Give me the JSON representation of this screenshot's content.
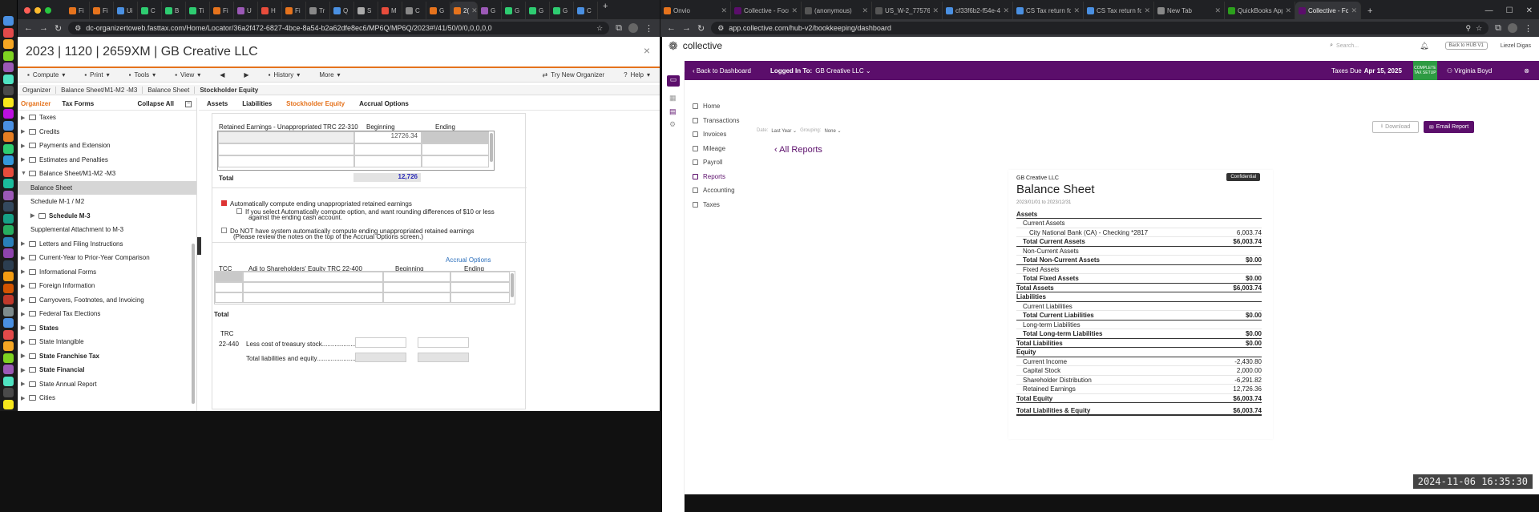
{
  "left_browser": {
    "tabs": [
      {
        "label": "Fi"
      },
      {
        "label": "Fi"
      },
      {
        "label": "Ui"
      },
      {
        "label": "C"
      },
      {
        "label": "B"
      },
      {
        "label": "Ti"
      },
      {
        "label": "Fi"
      },
      {
        "label": "U"
      },
      {
        "label": "H"
      },
      {
        "label": "Fi"
      },
      {
        "label": "Tr"
      },
      {
        "label": "Q"
      },
      {
        "label": "S"
      },
      {
        "label": "M"
      },
      {
        "label": "C"
      },
      {
        "label": "G"
      },
      {
        "label": "2("
      },
      {
        "label": "G"
      },
      {
        "label": "G"
      },
      {
        "label": "G"
      },
      {
        "label": "G"
      },
      {
        "label": "C"
      }
    ],
    "url": "dc-organizertoweb.fasttax.com/Home/Locator/36a2f472-6827-4bce-8a54-b2a62dfe8ec6/MP6Q/MP6Q/2023#!/41/50/0/0,0,0,0,0"
  },
  "fasttax": {
    "title": "2023 | 1120 | 2659XM | GB Creative LLC",
    "close": "×",
    "menu": [
      {
        "label": "Compute",
        "icon": "compute-icon"
      },
      {
        "label": "Print",
        "icon": "print-icon"
      },
      {
        "label": "Tools",
        "icon": "tools-icon"
      },
      {
        "label": "View",
        "icon": "view-icon"
      },
      {
        "label": "◀",
        "icon": ""
      },
      {
        "label": "▶",
        "icon": ""
      },
      {
        "label": "History",
        "icon": "history-icon"
      },
      {
        "label": "More",
        "icon": ""
      }
    ],
    "try_new": "Try New Organizer",
    "help": "Help",
    "crumbs": [
      "Organizer",
      "Balance Sheet/M1-M2 -M3",
      "Balance Sheet",
      "Stockholder Equity"
    ],
    "sidebar_tabs": {
      "organizer": "Organizer",
      "tax_forms": "Tax Forms",
      "collapse": "Collapse All"
    },
    "tree": [
      {
        "label": "Taxes",
        "bold": false,
        "indent": 0,
        "sel": false,
        "car": "▶"
      },
      {
        "label": "Credits",
        "bold": false,
        "indent": 0,
        "sel": false,
        "car": "▶"
      },
      {
        "label": "Payments and Extension",
        "bold": false,
        "indent": 0,
        "sel": false,
        "car": "▶"
      },
      {
        "label": "Estimates and Penalties",
        "bold": false,
        "indent": 0,
        "sel": false,
        "car": "▶"
      },
      {
        "label": "Balance Sheet/M1-M2 -M3",
        "bold": false,
        "indent": 0,
        "sel": false,
        "car": "▼"
      },
      {
        "label": "Balance Sheet",
        "bold": false,
        "indent": 1,
        "sel": true,
        "car": ""
      },
      {
        "label": "Schedule M-1 / M2",
        "bold": false,
        "indent": 1,
        "sel": false,
        "car": ""
      },
      {
        "label": "Schedule M-3",
        "bold": true,
        "indent": 1,
        "sel": false,
        "car": "▶"
      },
      {
        "label": "Supplemental Attachment to M-3",
        "bold": false,
        "indent": 1,
        "sel": false,
        "car": ""
      },
      {
        "label": "Letters and Filing Instructions",
        "bold": false,
        "indent": 0,
        "sel": false,
        "car": "▶"
      },
      {
        "label": "Current-Year to Prior-Year Comparison",
        "bold": false,
        "indent": 0,
        "sel": false,
        "car": "▶"
      },
      {
        "label": "Informational Forms",
        "bold": false,
        "indent": 0,
        "sel": false,
        "car": "▶"
      },
      {
        "label": "Foreign Information",
        "bold": false,
        "indent": 0,
        "sel": false,
        "car": "▶"
      },
      {
        "label": "Carryovers, Footnotes, and Invoicing",
        "bold": false,
        "indent": 0,
        "sel": false,
        "car": "▶"
      },
      {
        "label": "Federal Tax Elections",
        "bold": false,
        "indent": 0,
        "sel": false,
        "car": "▶"
      },
      {
        "label": "States",
        "bold": true,
        "indent": 0,
        "sel": false,
        "car": "▶"
      },
      {
        "label": "State Intangible",
        "bold": false,
        "indent": 0,
        "sel": false,
        "car": "▶"
      },
      {
        "label": "State Franchise Tax",
        "bold": true,
        "indent": 0,
        "sel": false,
        "car": "▶"
      },
      {
        "label": "State Financial",
        "bold": true,
        "indent": 0,
        "sel": false,
        "car": "▶"
      },
      {
        "label": "State Annual Report",
        "bold": false,
        "indent": 0,
        "sel": false,
        "car": "▶"
      },
      {
        "label": "Cities",
        "bold": false,
        "indent": 0,
        "sel": false,
        "car": "▶"
      }
    ],
    "form_tabs": [
      "Assets",
      "Liabilities",
      "Stockholder Equity",
      "Accrual Options"
    ],
    "re": {
      "header": "Retained Earnings - Unappropriated TRC 22-310",
      "beginning": "Beginning",
      "ending": "Ending",
      "value": "12726.34",
      "total_label": "Total",
      "total": "12,726"
    },
    "auto": {
      "label": "Automatically compute ending unappropriated retained earnings",
      "option1": "If you select Automatically compute option, and want rounding differences of $10 or less",
      "option1b": "against the ending cash account.",
      "option2": "Do NOT have system automatically compute ending unappropriated retained earnings",
      "option2b": "(Please review the notes on the top of the Accrual Options screen.)"
    },
    "accrual_link": "Accrual Options",
    "adj": {
      "tcc": "TCC",
      "header": "Adj to Shareholders' Equity TRC 22-400",
      "beginning": "Beginning",
      "ending": "Ending",
      "total_label": "Total"
    },
    "trc": {
      "trc": "TRC",
      "code": "22-440",
      "treasury": "Less cost of treasury stock....................................",
      "total_liab": "Total liabilities and equity.............................."
    }
  },
  "right_browser": {
    "tabs": [
      {
        "label": "Onvio"
      },
      {
        "label": "Collective - Focus"
      },
      {
        "label": "(anonymous)"
      },
      {
        "label": "US_W-2_7757616"
      },
      {
        "label": "cf33f6b2-f54e-49"
      },
      {
        "label": "CS Tax return for"
      },
      {
        "label": "CS Tax return for"
      },
      {
        "label": "New Tab"
      },
      {
        "label": "QuickBooks App"
      },
      {
        "label": "Collective - Focus"
      }
    ],
    "url": "app.collective.com/hub-v2/bookkeeping/dashboard"
  },
  "collective": {
    "brand": "collective",
    "search_placeholder": "Search...",
    "back_hub": "Back to HUB V1",
    "user": "Liezel Digas",
    "back_dashboard": "Back to Dashboard",
    "logged_in": "Logged In To:",
    "company": "GB Creative LLC",
    "taxes_due_label": "Taxes Due",
    "taxes_due": "Apr 15, 2025",
    "complete_setup": "COMPLETE TAX SETUP",
    "advisor": "Virginia Boyd",
    "nav": [
      "Home",
      "Transactions",
      "Invoices",
      "Mileage",
      "Payroll",
      "Reports",
      "Accounting",
      "Taxes"
    ],
    "date_label": "Date:",
    "date_value": "Last Year",
    "grouping_label": "Grouping:",
    "grouping_value": "None",
    "all_reports": "All Reports",
    "download": "Download",
    "email_report": "Email Report",
    "report": {
      "company": "GB Creative LLC",
      "title": "Balance Sheet",
      "confidential": "Confidential",
      "period": "2023/01/01 to 2023/12/31",
      "rows": [
        {
          "label": "Assets",
          "value": "",
          "type": "section"
        },
        {
          "label": "Current Assets",
          "value": "",
          "type": "sub"
        },
        {
          "label": "City National Bank (CA) - Checking *2817",
          "value": "6,003.74",
          "type": "item"
        },
        {
          "label": "Total Current Assets",
          "value": "$6,003.74",
          "type": "total"
        },
        {
          "label": "Non-Current Assets",
          "value": "",
          "type": "sub"
        },
        {
          "label": "Total Non-Current Assets",
          "value": "$0.00",
          "type": "total"
        },
        {
          "label": "Fixed Assets",
          "value": "",
          "type": "sub"
        },
        {
          "label": "Total Fixed Assets",
          "value": "$0.00",
          "type": "total"
        },
        {
          "label": "Total Assets",
          "value": "$6,003.74",
          "type": "grand"
        },
        {
          "label": "Liabilities",
          "value": "",
          "type": "section"
        },
        {
          "label": "Current Liabilities",
          "value": "",
          "type": "sub"
        },
        {
          "label": "Total Current Liabilities",
          "value": "$0.00",
          "type": "total"
        },
        {
          "label": "Long-term Liabilities",
          "value": "",
          "type": "sub"
        },
        {
          "label": "Total Long-term Liabilities",
          "value": "$0.00",
          "type": "total"
        },
        {
          "label": "Total Liabilities",
          "value": "$0.00",
          "type": "grand"
        },
        {
          "label": "Equity",
          "value": "",
          "type": "section"
        },
        {
          "label": "Current Income",
          "value": "-2,430.80",
          "type": "sub"
        },
        {
          "label": "Capital Stock",
          "value": "2,000.00",
          "type": "sub"
        },
        {
          "label": "Shareholder Distribution",
          "value": "-6,291.82",
          "type": "sub"
        },
        {
          "label": "Retained Earnings",
          "value": "12,726.36",
          "type": "sub"
        },
        {
          "label": "Total Equity",
          "value": "$6,003.74",
          "type": "grand"
        },
        {
          "label": "Total Liabilities & Equity",
          "value": "$6,003.74",
          "type": "grand"
        }
      ]
    }
  },
  "timestamp": "2024-11-06 16:35:30"
}
